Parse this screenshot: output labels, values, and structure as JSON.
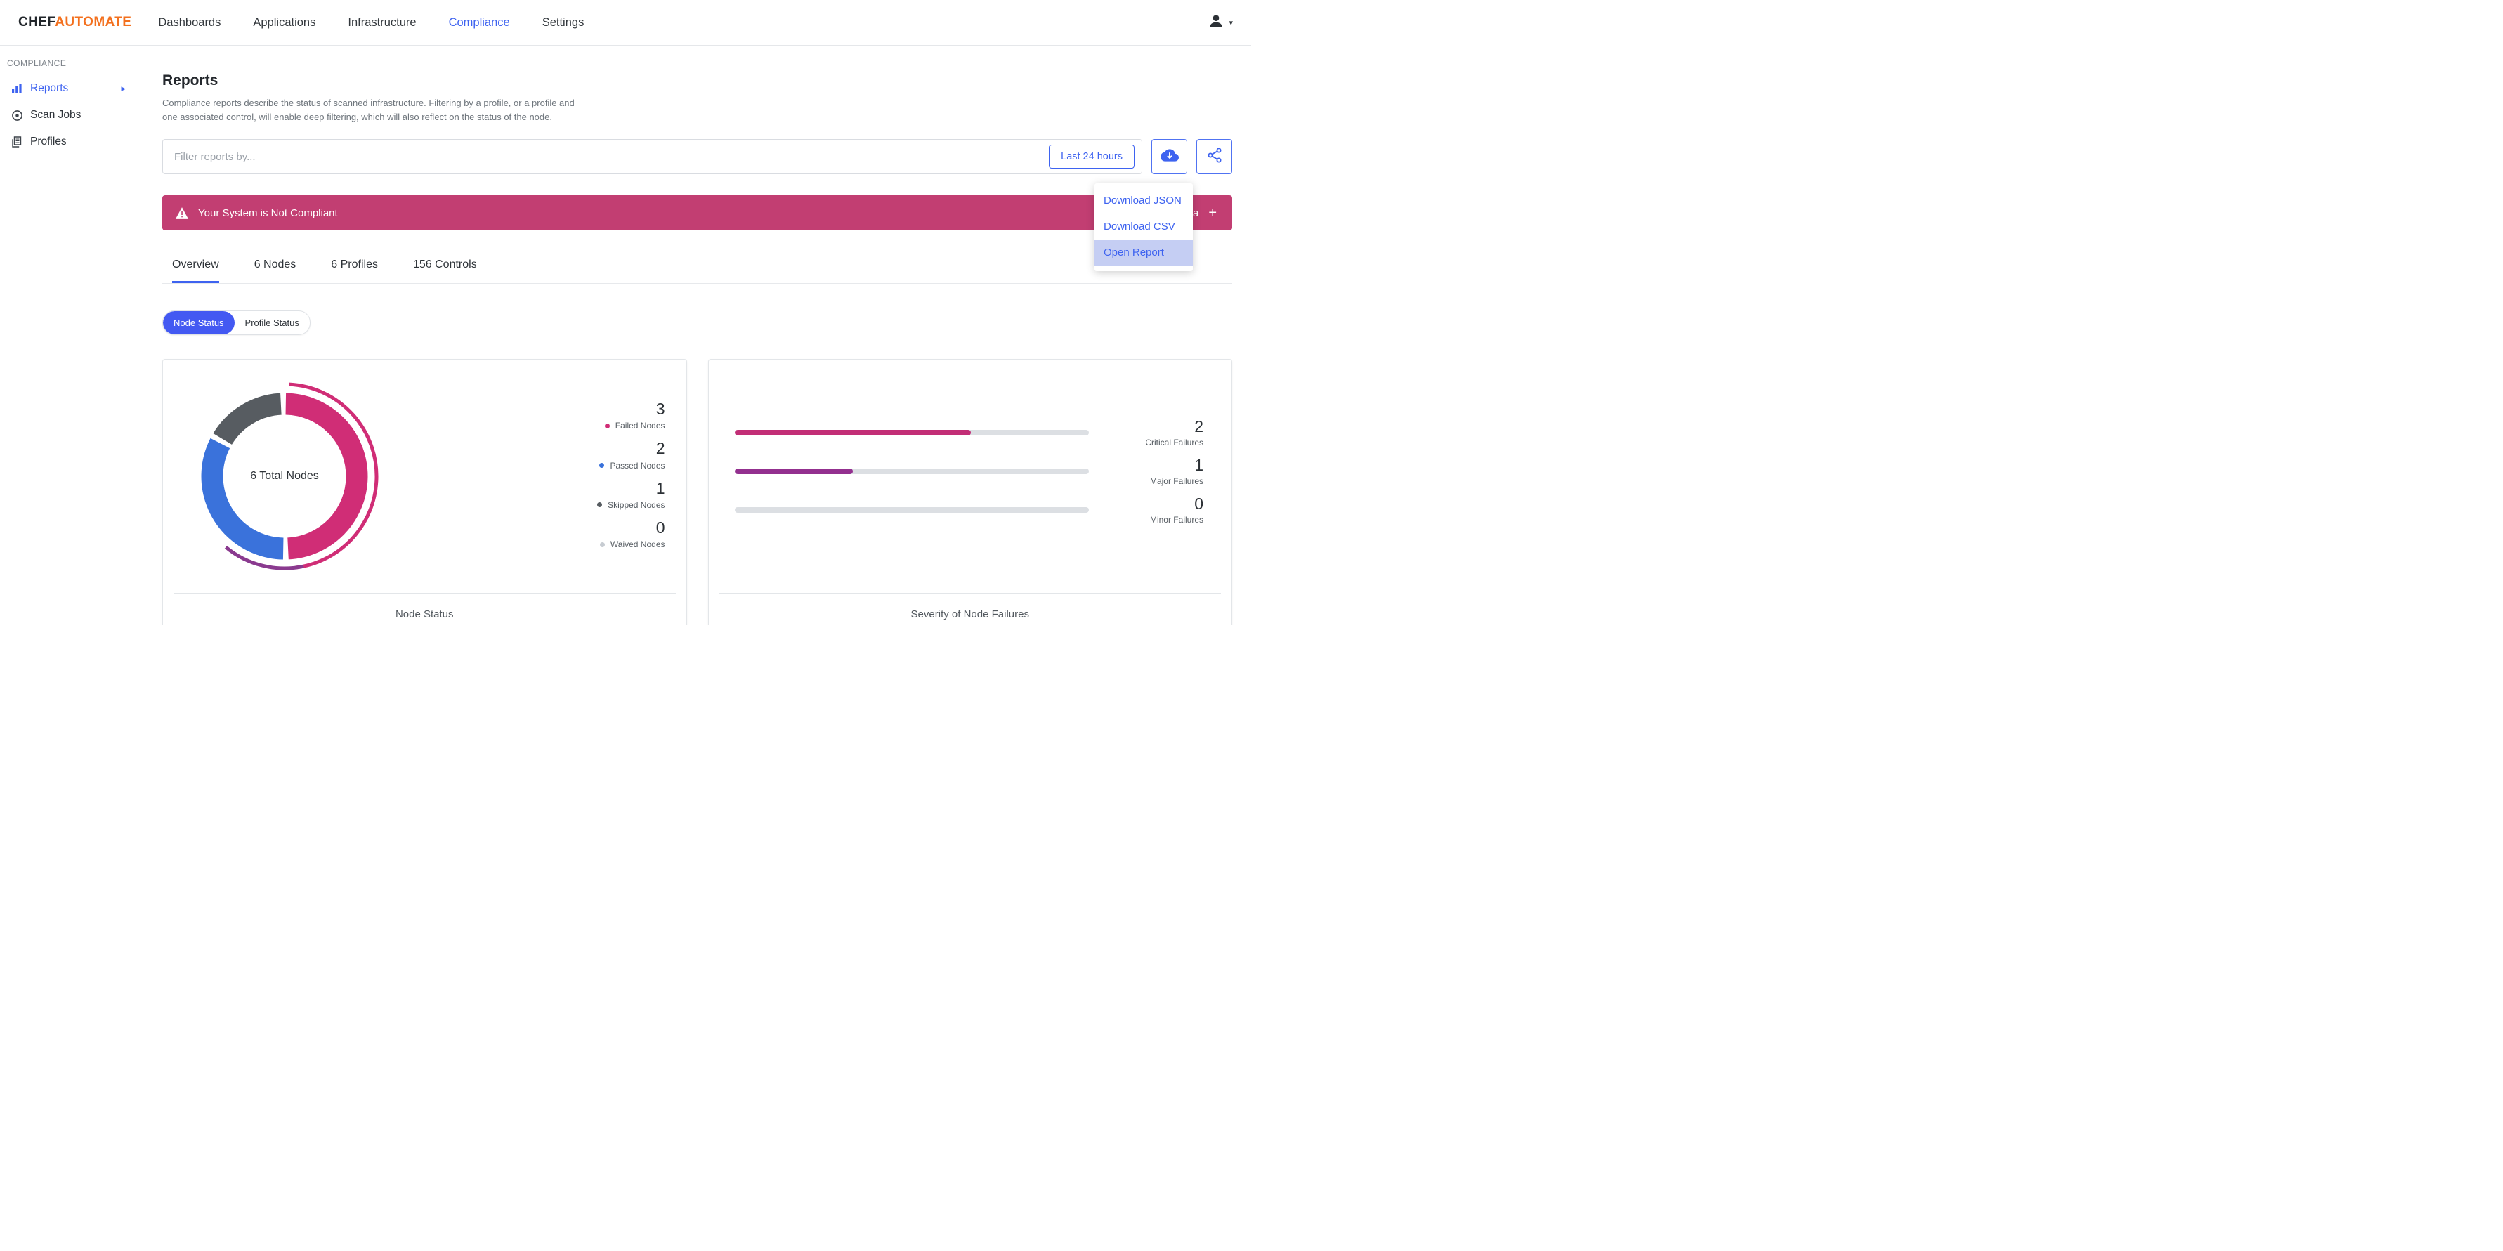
{
  "brand": {
    "chef": "CHEF",
    "automate": "AUTOMATE"
  },
  "navbar": {
    "items": [
      {
        "label": "Dashboards",
        "active": false
      },
      {
        "label": "Applications",
        "active": false
      },
      {
        "label": "Infrastructure",
        "active": false
      },
      {
        "label": "Compliance",
        "active": true
      },
      {
        "label": "Settings",
        "active": false
      }
    ]
  },
  "sidebar": {
    "section": "COMPLIANCE",
    "items": [
      {
        "label": "Reports",
        "icon": "bar-chart-icon",
        "active": true
      },
      {
        "label": "Scan Jobs",
        "icon": "scan-target-icon",
        "active": false
      },
      {
        "label": "Profiles",
        "icon": "stacked-docs-icon",
        "active": false
      }
    ]
  },
  "page": {
    "title": "Reports",
    "description_line1": "Compliance reports describe the status of scanned infrastructure. Filtering by a profile, or a profile and",
    "description_line2": "one associated control, will enable deep filtering, which will also reflect on the status of the node."
  },
  "filter": {
    "placeholder": "Filter reports by...",
    "time_button": "Last 24 hours"
  },
  "download_menu": {
    "items": [
      {
        "label": "Download JSON",
        "highlighted": false
      },
      {
        "label": "Download CSV",
        "highlighted": false
      },
      {
        "label": "Open Report",
        "highlighted": true
      }
    ]
  },
  "banner": {
    "message": "Your System is Not Compliant",
    "metadata_label": "Report Metadata",
    "expand_symbol": "+"
  },
  "tabs": [
    {
      "label": "Overview",
      "active": true
    },
    {
      "label": "6 Nodes",
      "active": false
    },
    {
      "label": "6 Profiles",
      "active": false
    },
    {
      "label": "156 Controls",
      "active": false
    }
  ],
  "status_toggle": [
    {
      "label": "Node Status",
      "active": true
    },
    {
      "label": "Profile Status",
      "active": false
    }
  ],
  "icons": {
    "user_chevron": "▾",
    "reports_arrow": "▸"
  },
  "colors": {
    "accent_blue": "#3e63f0",
    "brand_orange": "#f3701e",
    "banner_pink": "#c23e72",
    "menu_highlight": "#c5cef3"
  },
  "chart_data": [
    {
      "type": "pie",
      "variant": "donut",
      "title": "Node Status",
      "center_label": "6 Total Nodes",
      "categories": [
        "Failed Nodes",
        "Passed Nodes",
        "Skipped Nodes",
        "Waived Nodes"
      ],
      "values": [
        3,
        2,
        1,
        0
      ],
      "total": 6,
      "colors": [
        "#d02d76",
        "#3a72db",
        "#575c61",
        "#c7ccd2"
      ],
      "legend_position": "right"
    },
    {
      "type": "bar",
      "orientation": "horizontal",
      "title": "Severity of Node Failures",
      "categories": [
        "Critical Failures",
        "Major Failures",
        "Minor Failures"
      ],
      "values": [
        2,
        1,
        0
      ],
      "xlim": [
        0,
        3
      ],
      "colors": [
        "#c22e76",
        "#93308f",
        "#dcdfe3"
      ],
      "track_color": "#dcdfe3",
      "grid": false
    }
  ]
}
